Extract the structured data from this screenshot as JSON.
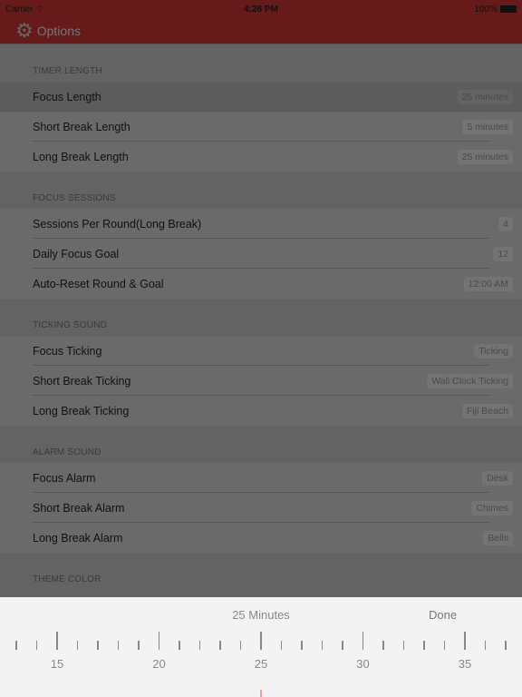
{
  "status_bar": {
    "carrier": "Carrier",
    "time": "4:28 PM",
    "battery": "100%"
  },
  "nav": {
    "title": "Options",
    "icon": "gear-icon"
  },
  "sections": [
    {
      "header": "TIMER LENGTH",
      "rows": [
        {
          "label": "Focus Length",
          "value": "25 minutes",
          "selected": true
        },
        {
          "label": "Short Break Length",
          "value": "5 minutes"
        },
        {
          "label": "Long Break Length",
          "value": "25 minutes"
        }
      ]
    },
    {
      "header": "FOCUS SESSIONS",
      "rows": [
        {
          "label": "Sessions Per Round(Long Break)",
          "value": "4"
        },
        {
          "label": "Daily Focus Goal",
          "value": "12"
        },
        {
          "label": "Auto-Reset Round & Goal",
          "value": "12:00 AM"
        }
      ]
    },
    {
      "header": "TICKING SOUND",
      "rows": [
        {
          "label": "Focus Ticking",
          "value": "Ticking"
        },
        {
          "label": "Short Break Ticking",
          "value": "Wall Clock Ticking"
        },
        {
          "label": "Long Break Ticking",
          "value": "Fiji Beach"
        }
      ]
    },
    {
      "header": "ALARM SOUND",
      "rows": [
        {
          "label": "Focus Alarm",
          "value": "Desk"
        },
        {
          "label": "Short Break Alarm",
          "value": "Chimes"
        },
        {
          "label": "Long Break Alarm",
          "value": "Bells"
        }
      ]
    },
    {
      "header": "THEME COLOR",
      "rows": []
    }
  ],
  "picker": {
    "title": "25 Minutes",
    "done": "Done",
    "selected_value": 25,
    "min_visible": 13,
    "max_visible": 37,
    "labels": [
      "15",
      "20",
      "25",
      "30",
      "35"
    ],
    "indicator_color": "#f4a0a0"
  }
}
